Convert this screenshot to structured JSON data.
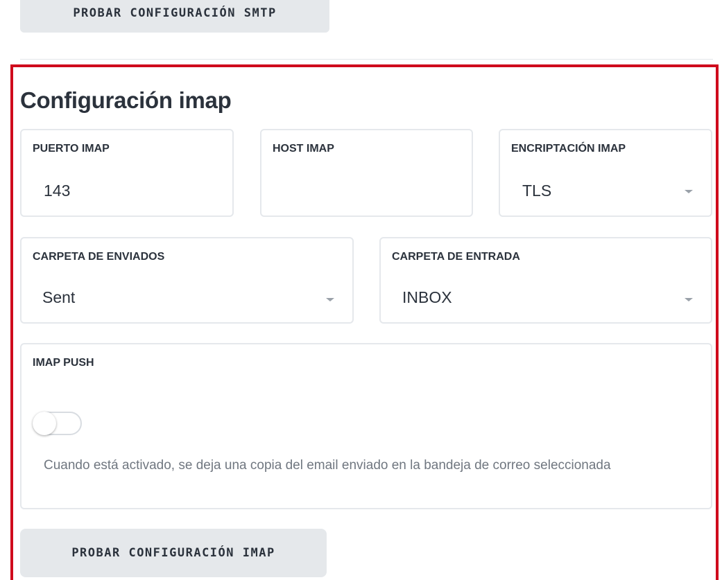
{
  "buttons": {
    "test_smtp": "PROBAR CONFIGURACIÓN SMTP",
    "test_imap": "PROBAR CONFIGURACIÓN IMAP"
  },
  "imap_section": {
    "title": "Configuración imap",
    "fields": {
      "puerto": {
        "label": "PUERTO IMAP",
        "value": "143"
      },
      "host": {
        "label": "HOST IMAP",
        "value": ""
      },
      "encriptacion": {
        "label": "ENCRIPTACIÓN IMAP",
        "value": "TLS"
      },
      "carpeta_enviados": {
        "label": "CARPETA DE ENVIADOS",
        "value": "Sent"
      },
      "carpeta_entrada": {
        "label": "CARPETA DE ENTRADA",
        "value": "INBOX"
      }
    },
    "push": {
      "label": "IMAP PUSH",
      "enabled": false,
      "description": "Cuando está activado, se deja una copia del email enviado en la bandeja de correo seleccionada"
    }
  },
  "icons": {
    "select_caret": "chevron-down-icon"
  },
  "colors": {
    "highlight_border": "#cf0a1c",
    "button_bg": "#e5e8eb",
    "text_primary": "#2b323c",
    "text_muted": "#707780",
    "field_border": "#e5e8ec"
  }
}
